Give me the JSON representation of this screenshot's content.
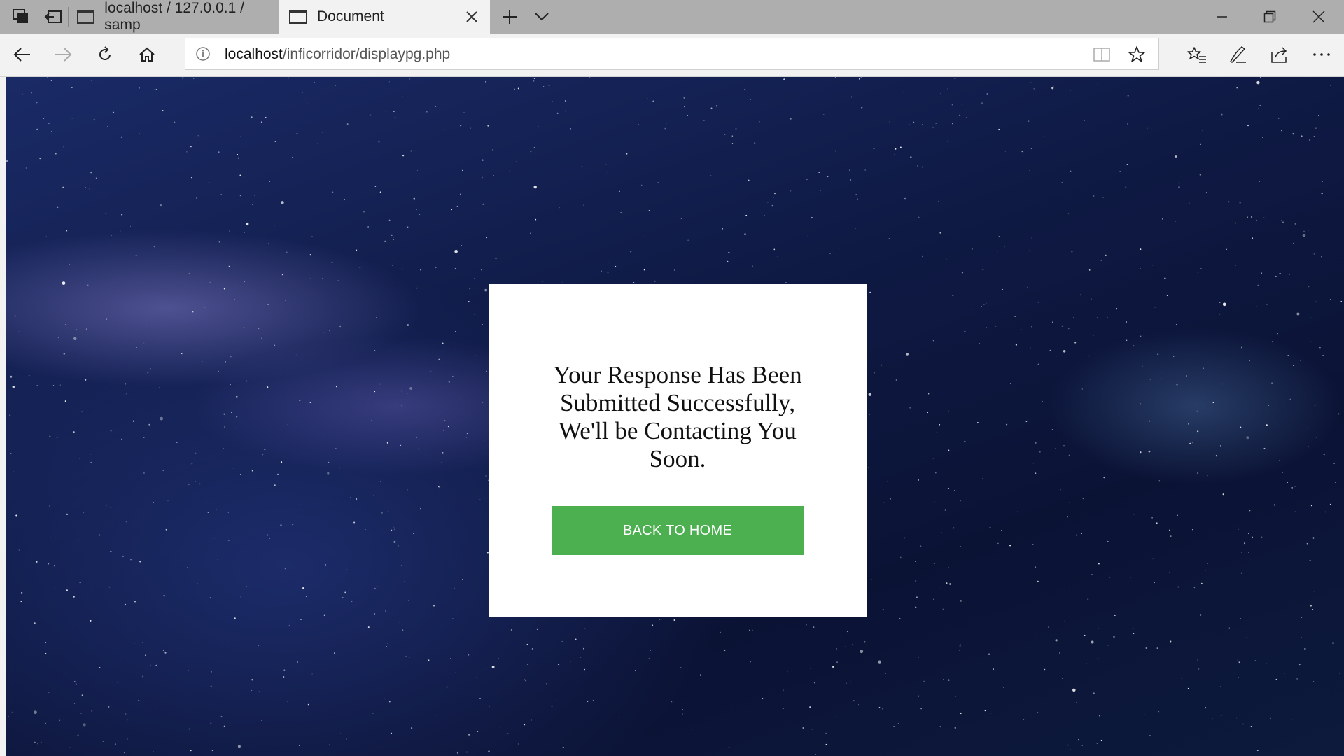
{
  "browser": {
    "tabs": [
      {
        "title": "localhost / 127.0.0.1 / samp",
        "active": false
      },
      {
        "title": "Document",
        "active": true
      }
    ],
    "address": {
      "host": "localhost",
      "path": "/inficorridor/displaypg.php"
    }
  },
  "page": {
    "message": "Your Response Has Been Submitted Successfully, We'll be Contacting You Soon.",
    "button_label": "BACK TO HOME",
    "button_color": "#4caf50"
  }
}
